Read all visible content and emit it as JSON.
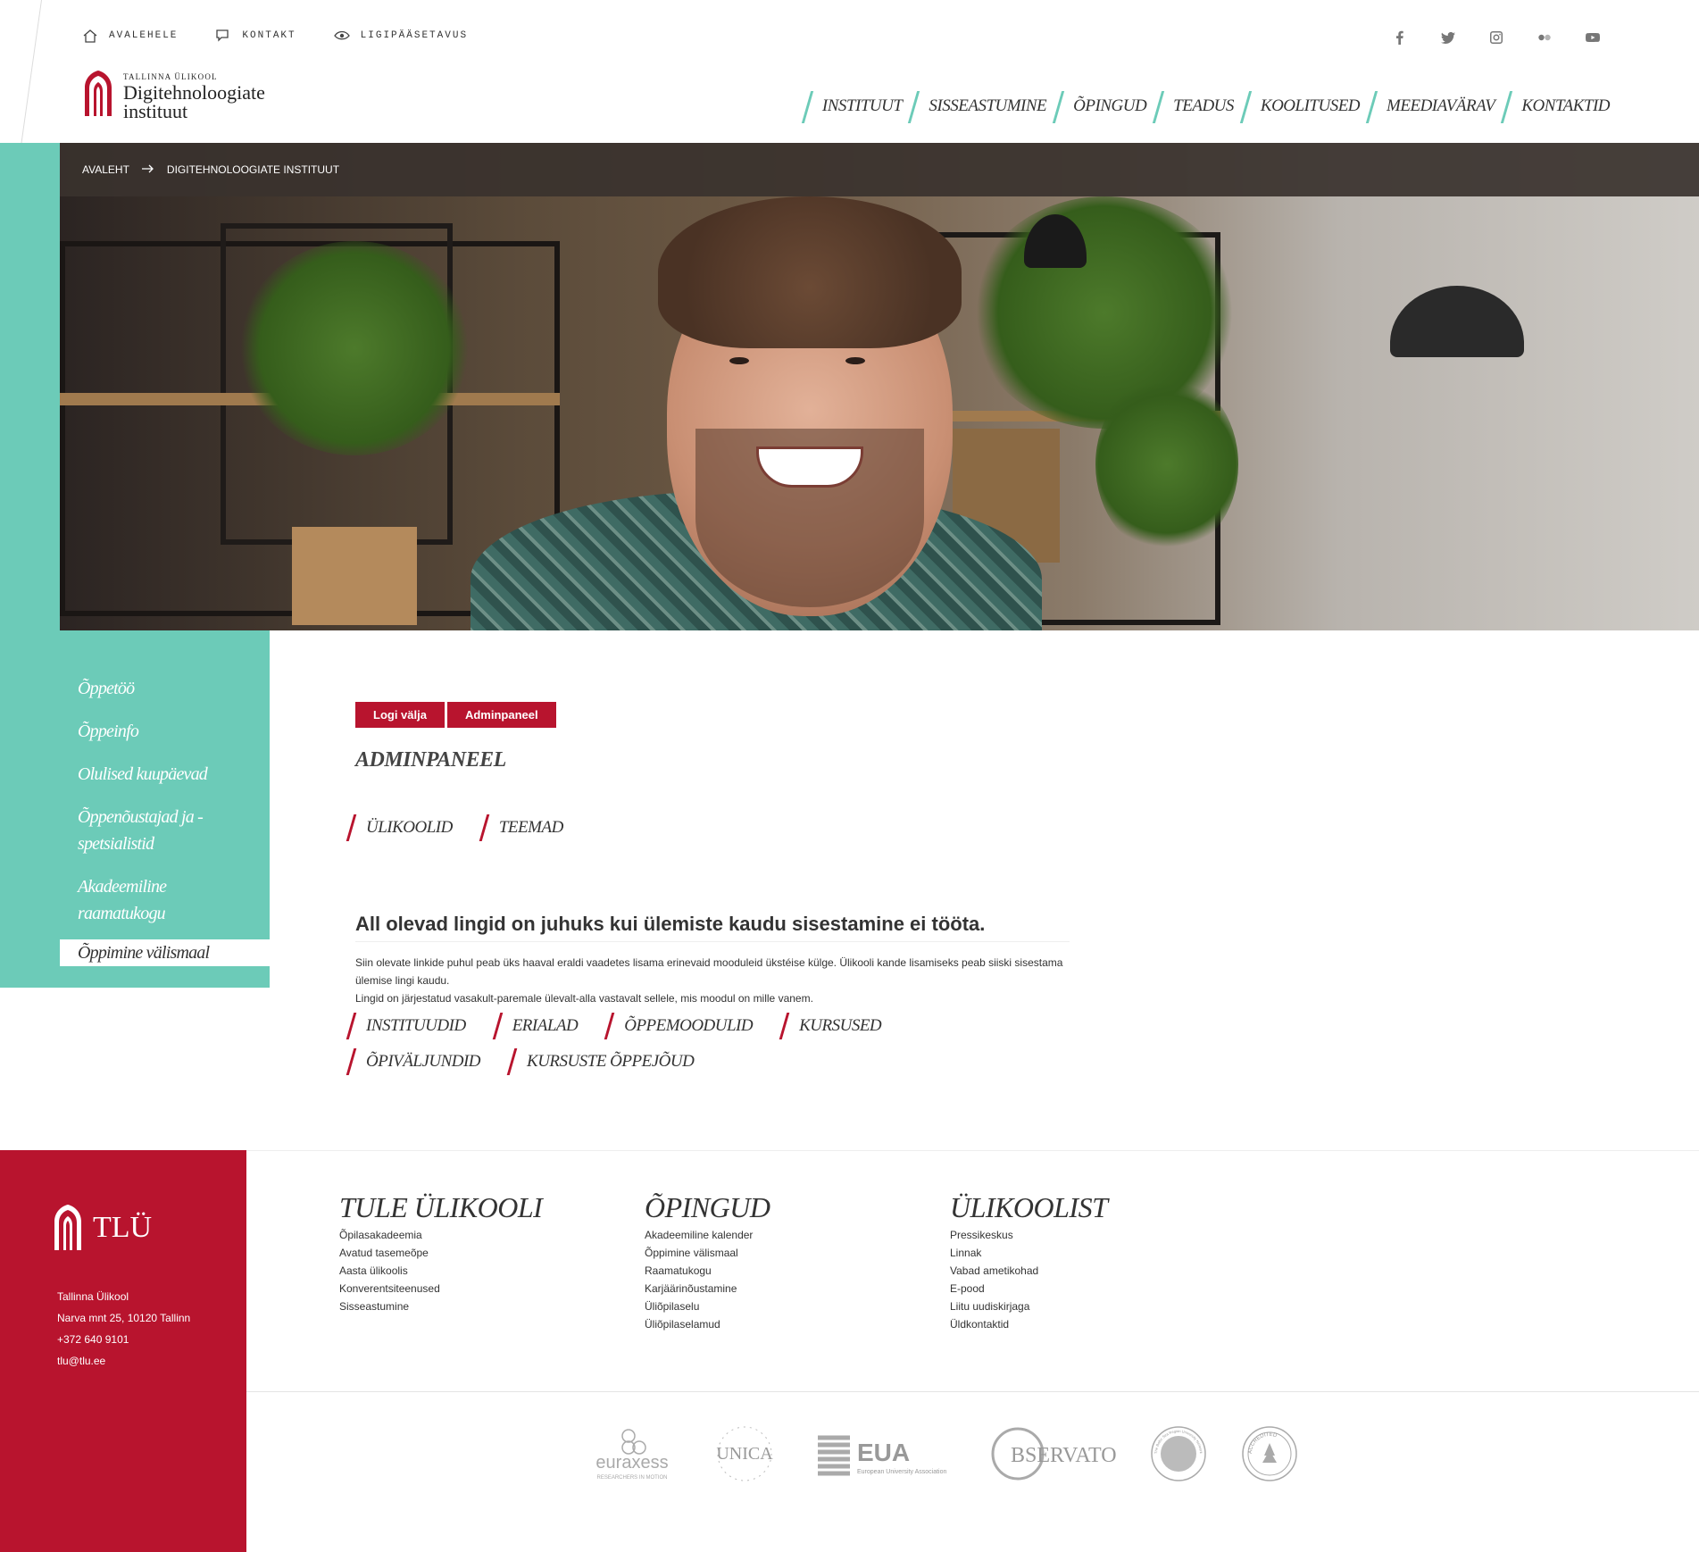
{
  "top_links": [
    {
      "label": "AVALEHELE",
      "icon": "home-icon"
    },
    {
      "label": "KONTAKT",
      "icon": "chat-icon"
    },
    {
      "label": "LIGIPÄÄSETAVUS",
      "icon": "eye-icon"
    }
  ],
  "social": [
    "facebook-icon",
    "twitter-icon",
    "instagram-icon",
    "flickr-icon",
    "youtube-icon"
  ],
  "logo": {
    "small": "TALLINNA ÜLIKOOL",
    "line1": "Digitehnoloogiate",
    "line2": "instituut"
  },
  "main_nav": [
    "INSTITUUT",
    "SISSEASTUMINE",
    "ÕPINGUD",
    "TEADUS",
    "KOOLITUSED",
    "MEEDIAVÄRAV",
    "KONTAKTID"
  ],
  "breadcrumb": {
    "home": "AVALEHT",
    "current": "DIGITEHNOLOOGIATE INSTITUUT"
  },
  "side_nav": [
    "Õppetöö",
    "Õppeinfo",
    "Olulised kuupäevad",
    "Õppenõustajad ja -spetsialistid",
    "Akadeemiline raamatukogu",
    "Õppimine välismaal"
  ],
  "buttons": {
    "logout": "Logi välja",
    "admin": "Adminpaneel"
  },
  "admin_title": "ADMINPANEEL",
  "admin_links": [
    "ÜLIKOOLID",
    "TEEMAD"
  ],
  "sub_heading": "All olevad lingid on juhuks kui ülemiste kaudu sisestamine ei tööta.",
  "paragraphs": [
    "Siin olevate linkide puhul peab üks haaval eraldi vaadetes lisama erinevaid mooduleid ükstéise külge. Ülikooli kande lisamiseks peab siiski sisestama ülemise lingi kaudu.",
    "Lingid on järjestatud vasakult-paremale ülevalt-alla vastavalt sellele, mis moodul on mille vanem."
  ],
  "module_links_row1": [
    "INSTITUUDID",
    "ERIALAD",
    "ÕPPEMOODULID",
    "KURSUSED"
  ],
  "module_links_row2": [
    "ÕPIVÄLJUNDID",
    "KURSUSTE ÕPPEJÕUD"
  ],
  "footer": {
    "logo_text": "TLÜ",
    "address": [
      "Tallinna Ülikool",
      "Narva mnt 25, 10120 Tallinn",
      "+372 640 9101",
      "tlu@tlu.ee"
    ],
    "columns": [
      {
        "title": "TULE ÜLIKOOLI",
        "links": [
          "Õpilasakadeemia",
          "Avatud tasemeõpe",
          "Aasta ülikoolis",
          "Konverentsiteenused",
          "Sisseastumine"
        ]
      },
      {
        "title": "ÕPINGUD",
        "links": [
          "Akadeemiline kalender",
          "Õppimine välismaal",
          "Raamatukogu",
          "Karjäärinõustamine",
          "Üliõpilaselu",
          "Üliõpilaselamud"
        ]
      },
      {
        "title": "ÜLIKOOLIST",
        "links": [
          "Pressikeskus",
          "Linnak",
          "Vabad ametikohad",
          "E-pood",
          "Liitu uudiskirjaga",
          "Üldkontaktid"
        ]
      }
    ],
    "partners": {
      "euraxess": "euraxess",
      "euraxess_sub": "RESEARCHERS IN MOTION",
      "unica": "UNICA",
      "eua": "EUA",
      "eua_sub": "European University Association",
      "observatory": "BSERVATORY",
      "bsrun": "The Baltic Sea Region University Network",
      "accredited": "ACCREDITED"
    }
  },
  "colors": {
    "teal": "#6ccbb8",
    "red": "#b8142e"
  }
}
